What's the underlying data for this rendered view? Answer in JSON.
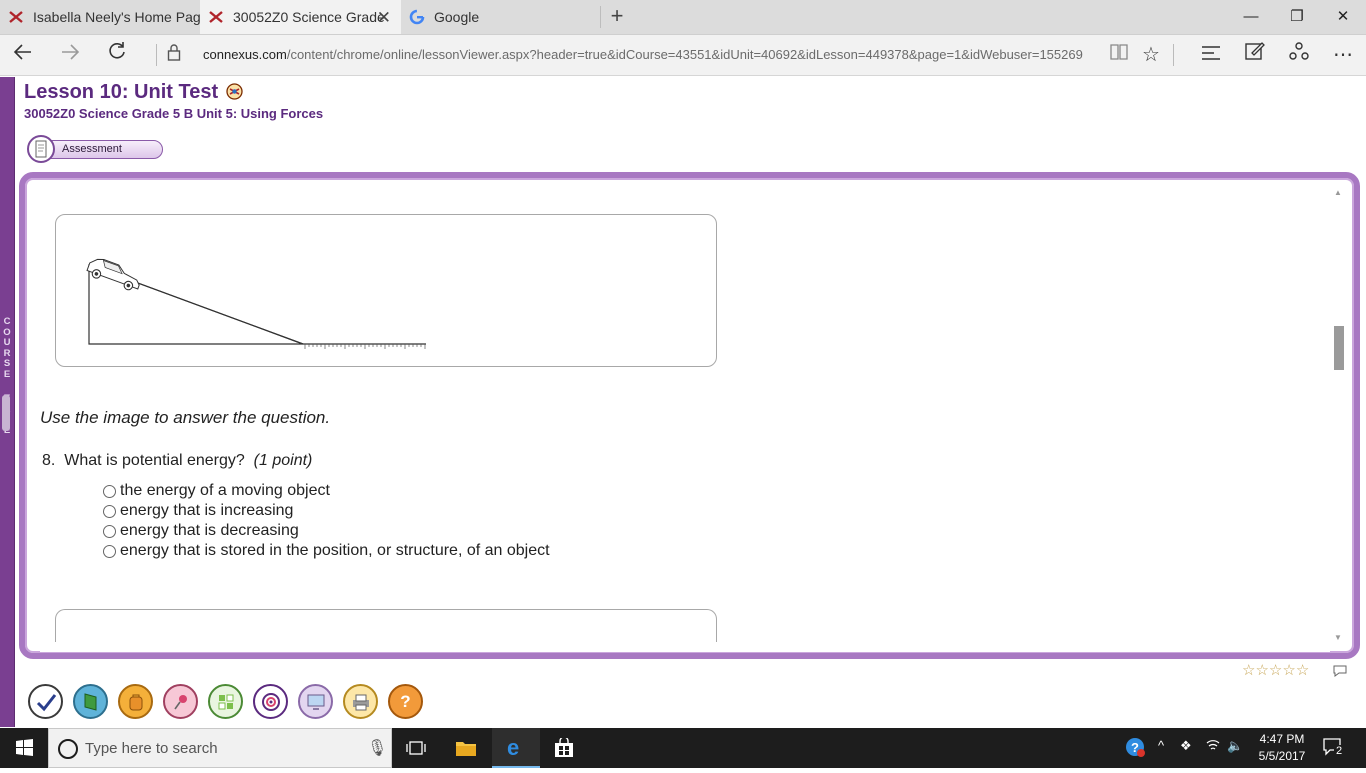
{
  "browser": {
    "tabs": [
      {
        "label": "Isabella Neely's Home Page",
        "icon": "connexus-x-icon",
        "active": false
      },
      {
        "label": "30052Z0 Science Grade",
        "icon": "connexus-x-icon",
        "active": true
      },
      {
        "label": "Google",
        "icon": "google-g-icon",
        "active": false
      }
    ],
    "url_domain": "connexus.com",
    "url_path": "/content/chrome/online/lessonViewer.aspx?header=true&idCourse=43551&idUnit=40692&idLesson=449378&page=1&idWebuser=155269"
  },
  "course_tree": {
    "label": "COURSE TREE"
  },
  "lesson": {
    "title": "Lesson 10: Unit Test",
    "course_line": "30052Z0 Science Grade 5 B  Unit 5: Using Forces",
    "section_tab": "Assessment"
  },
  "question": {
    "instruction": "Use the image to answer the question.",
    "number": "8.",
    "text": "What is potential energy?",
    "points": "(1 point)",
    "options": [
      "the energy of a moving object",
      "energy that is increasing",
      "energy that is decreasing",
      "energy that is stored in the position, or structure, of an object"
    ]
  },
  "rating": {
    "stars": 5,
    "filled": 0
  },
  "toolbar": [
    "check-icon",
    "book-icon",
    "backpack-icon",
    "pin-icon",
    "puzzle-icon",
    "target-icon",
    "screen-icon",
    "printer-icon",
    "help-icon"
  ],
  "taskbar": {
    "search_placeholder": "Type here to search",
    "time": "4:47 PM",
    "date": "5/5/2017",
    "notifications": "2"
  },
  "colors": {
    "accent": "#5b2a7f",
    "frame": "#a878c2"
  }
}
